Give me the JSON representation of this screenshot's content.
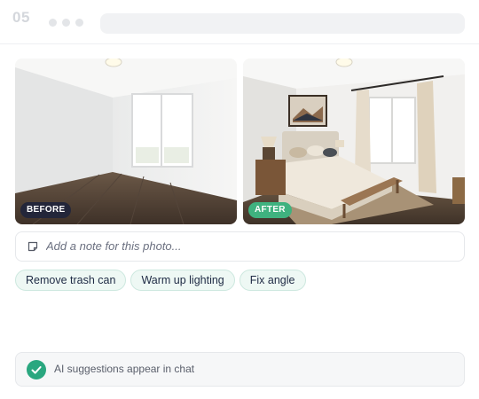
{
  "header": {
    "step_number": "05"
  },
  "photos": {
    "before_label": "BEFORE",
    "after_label": "AFTER"
  },
  "note": {
    "placeholder": "Add a note for this photo..."
  },
  "suggestions": [
    {
      "label": "Remove trash can"
    },
    {
      "label": "Warm up lighting"
    },
    {
      "label": "Fix angle"
    }
  ],
  "banner": {
    "text": "AI suggestions appear in chat"
  },
  "colors": {
    "accent_green": "#3fb27f",
    "before_tag": "#23263a",
    "chip_bg": "#eef8f4",
    "check_green": "#2aa77f"
  },
  "icons": {
    "note": "note-icon",
    "check": "check-icon"
  }
}
